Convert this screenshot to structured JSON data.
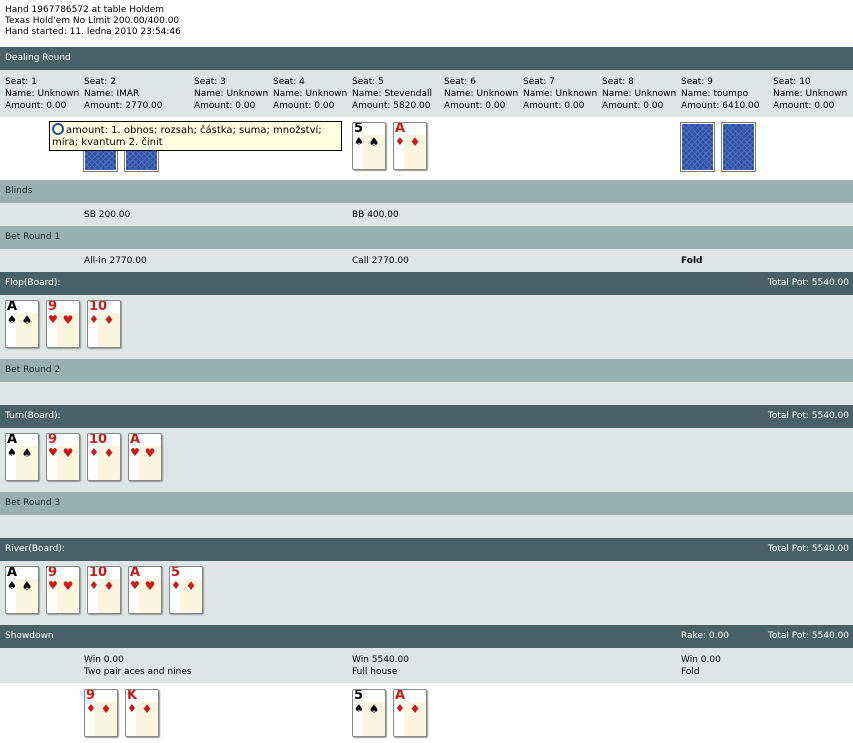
{
  "header": {
    "line1": "Hand 1967786572 at table Holdem",
    "line2": "Texas Hold'em No Limit 200.00/400.00",
    "line3": "Hand started: 11. ledna 2010 23:54:46"
  },
  "sections": {
    "dealing": "Dealing Round",
    "blinds": "Blinds",
    "bet1": "Bet Round 1",
    "flop": "Flop(Board):",
    "bet2": "Bet Round 2",
    "turn": "Turn(Board):",
    "bet3": "Bet Round 3",
    "river": "River(Board):",
    "showdown": "Showdown"
  },
  "total_pot": "Total Pot: 5540.00",
  "rake": "Rake: 0.00",
  "seats": [
    {
      "seat": "Seat: 1",
      "name": "Name: Unknown",
      "amount": "Amount: 0.00"
    },
    {
      "seat": "Seat: 2",
      "name": "Name: IMAR",
      "amount": "Amount: 2770.00"
    },
    {
      "seat": "Seat: 3",
      "name": "Name: Unknown",
      "amount": "Amount: 0.00"
    },
    {
      "seat": "Seat: 4",
      "name": "Name: Unknown",
      "amount": "Amount: 0.00"
    },
    {
      "seat": "Seat: 5",
      "name": "Name: Stevendall",
      "amount": "Amount: 5820.00"
    },
    {
      "seat": "Seat: 6",
      "name": "Name: Unknown",
      "amount": "Amount: 0.00"
    },
    {
      "seat": "Seat: 7",
      "name": "Name: Unknown",
      "amount": "Amount: 0.00"
    },
    {
      "seat": "Seat: 8",
      "name": "Name: Unknown",
      "amount": "Amount: 0.00"
    },
    {
      "seat": "Seat: 9",
      "name": "Name: toumpo",
      "amount": "Amount: 6410.00"
    },
    {
      "seat": "Seat: 10",
      "name": "Name: Unknown",
      "amount": "Amount: 0.00"
    }
  ],
  "tooltip": "amount: 1. obnos; rozsah; částka; suma; množství; míra; kvantum 2. činit",
  "blinds": {
    "sb": "SB 200.00",
    "bb": "BB 400.00"
  },
  "bet1": {
    "p2": "All-in 2770.00",
    "p5": "Call 2770.00",
    "p9": "Fold"
  },
  "cards": {
    "hole5": [
      {
        "rank": "5",
        "suit": "♠",
        "color": "blk"
      },
      {
        "rank": "A",
        "suit": "♦",
        "color": "red"
      }
    ],
    "flop": [
      {
        "rank": "A",
        "suit": "♠",
        "color": "blk"
      },
      {
        "rank": "9",
        "suit": "♥",
        "color": "red"
      },
      {
        "rank": "10",
        "suit": "♦",
        "color": "red"
      }
    ],
    "turn": [
      {
        "rank": "A",
        "suit": "♠",
        "color": "blk"
      },
      {
        "rank": "9",
        "suit": "♥",
        "color": "red"
      },
      {
        "rank": "10",
        "suit": "♦",
        "color": "red"
      },
      {
        "rank": "A",
        "suit": "♥",
        "color": "red"
      }
    ],
    "river": [
      {
        "rank": "A",
        "suit": "♠",
        "color": "blk"
      },
      {
        "rank": "9",
        "suit": "♥",
        "color": "red"
      },
      {
        "rank": "10",
        "suit": "♦",
        "color": "red"
      },
      {
        "rank": "A",
        "suit": "♥",
        "color": "red"
      },
      {
        "rank": "5",
        "suit": "♦",
        "color": "red"
      }
    ],
    "show2": [
      {
        "rank": "9",
        "suit": "♦",
        "color": "red"
      },
      {
        "rank": "K",
        "suit": "♦",
        "color": "red"
      }
    ],
    "show5": [
      {
        "rank": "5",
        "suit": "♠",
        "color": "blk"
      },
      {
        "rank": "A",
        "suit": "♦",
        "color": "red"
      }
    ]
  },
  "showdown": {
    "p2": {
      "win": "Win 0.00",
      "desc": "Two pair aces and nines"
    },
    "p5": {
      "win": "Win 5540.00",
      "desc": "Full house"
    },
    "p9": {
      "win": "Win 0.00",
      "desc": "Fold"
    }
  }
}
